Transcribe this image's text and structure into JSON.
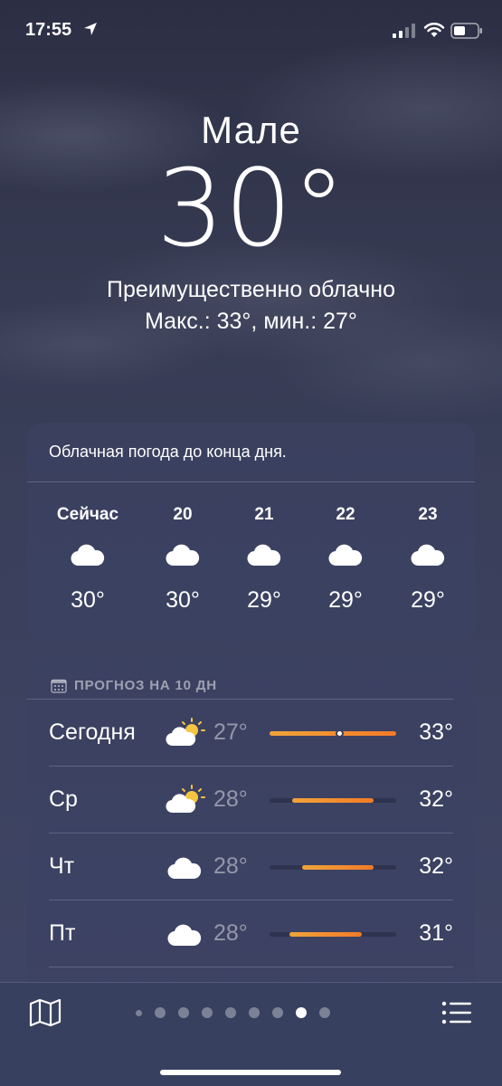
{
  "status_bar": {
    "time": "17:55"
  },
  "hero": {
    "city": "Мале",
    "temperature": "30°",
    "condition": "Преимущественно облачно",
    "hilo": "Макс.: 33°, мин.: 27°"
  },
  "hourly": {
    "summary": "Облачная погода до конца дня.",
    "items": [
      {
        "label": "Сейчас",
        "icon": "cloud-icon",
        "temp": "30°"
      },
      {
        "label": "20",
        "icon": "cloud-icon",
        "temp": "30°"
      },
      {
        "label": "21",
        "icon": "cloud-icon",
        "temp": "29°"
      },
      {
        "label": "22",
        "icon": "cloud-icon",
        "temp": "29°"
      },
      {
        "label": "23",
        "icon": "cloud-icon",
        "temp": "29°"
      }
    ]
  },
  "forecast": {
    "header": "ПРОГНОЗ НА 10 ДН",
    "rows": [
      {
        "day": "Сегодня",
        "icon": "partly-sunny-icon",
        "low": "27°",
        "high": "33°",
        "bar_start": 0.0,
        "bar_end": 1.0,
        "current": 0.55
      },
      {
        "day": "Ср",
        "icon": "partly-sunny-icon",
        "low": "28°",
        "high": "32°",
        "bar_start": 0.18,
        "bar_end": 0.82
      },
      {
        "day": "Чт",
        "icon": "cloud-icon",
        "low": "28°",
        "high": "32°",
        "bar_start": 0.26,
        "bar_end": 0.82
      },
      {
        "day": "Пт",
        "icon": "cloud-icon",
        "low": "28°",
        "high": "31°",
        "bar_start": 0.16,
        "bar_end": 0.73
      }
    ]
  },
  "pager": {
    "count": 9,
    "active_index": 7
  },
  "colors": {
    "bar_start": "#f0a43a",
    "bar_end": "#f37a28",
    "sun": "#f5c542"
  }
}
